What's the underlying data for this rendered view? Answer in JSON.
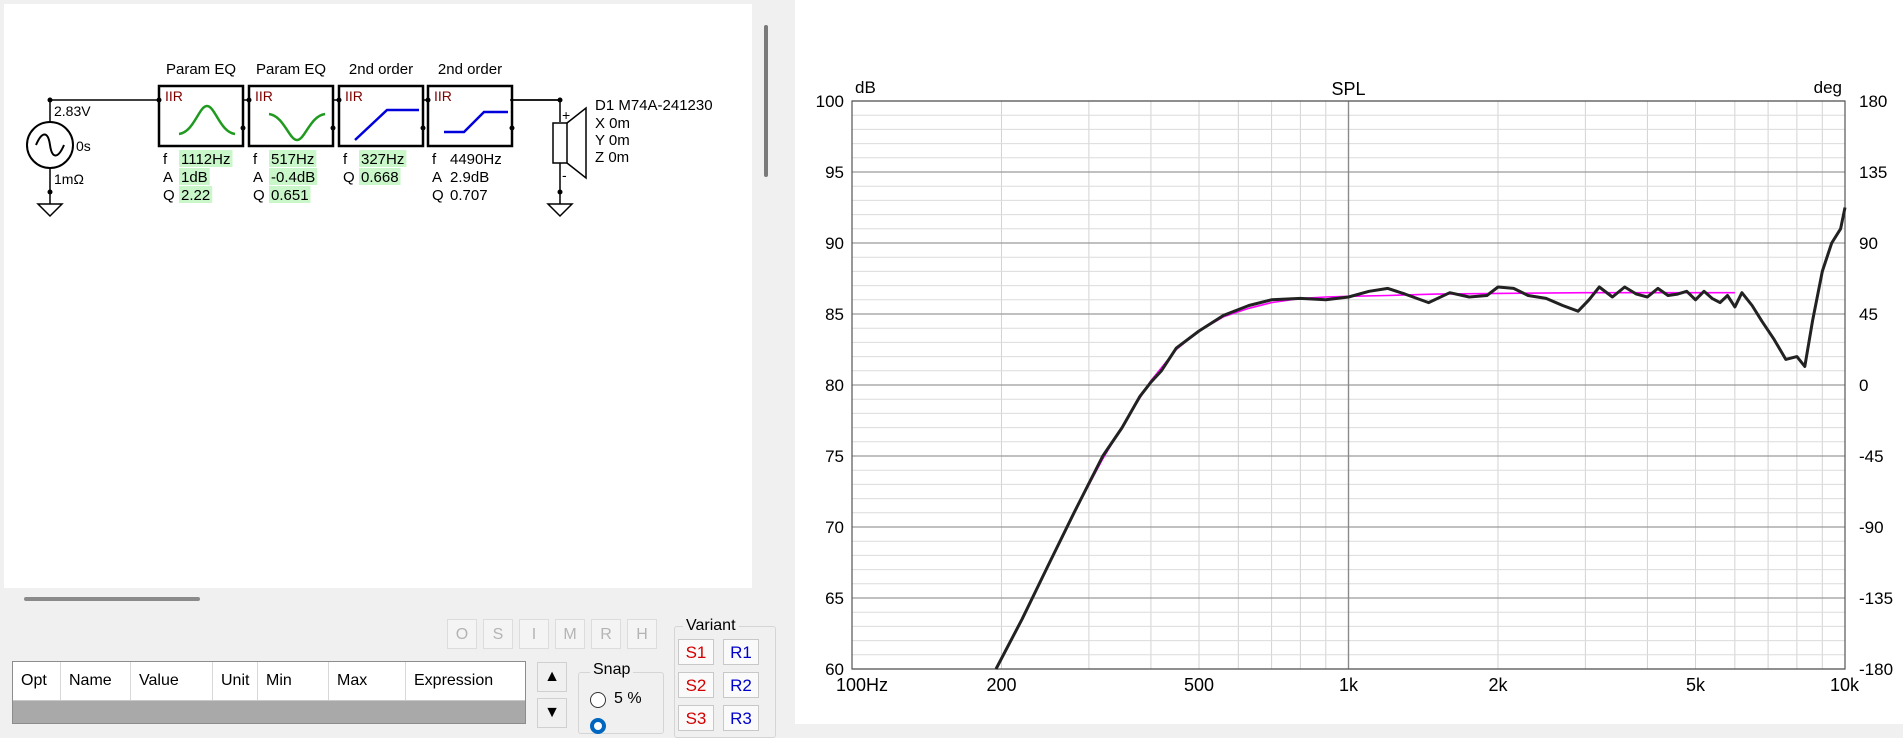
{
  "schematic": {
    "source": {
      "voltage": "2.83V",
      "delay": "0s",
      "impedance": "1mΩ"
    },
    "blocks": [
      {
        "title": "Param EQ",
        "tag": "IIR",
        "shape": "peak",
        "params": [
          {
            "key": "f",
            "val": "1112Hz",
            "hl": true
          },
          {
            "key": "A",
            "val": "1dB",
            "hl": true
          },
          {
            "key": "Q",
            "val": "2.22",
            "hl": true
          }
        ]
      },
      {
        "title": "Param EQ",
        "tag": "IIR",
        "shape": "dip",
        "params": [
          {
            "key": "f",
            "val": "517Hz",
            "hl": true
          },
          {
            "key": "A",
            "val": "-0.4dB",
            "hl": true
          },
          {
            "key": "Q",
            "val": "0.651",
            "hl": true
          }
        ]
      },
      {
        "title": "2nd order",
        "tag": "IIR",
        "shape": "highpass",
        "params": [
          {
            "key": "f",
            "val": "327Hz",
            "hl": true
          },
          {
            "key": "Q",
            "val": "0.668",
            "hl": true
          }
        ]
      },
      {
        "title": "2nd order",
        "tag": "IIR",
        "shape": "shelf",
        "params": [
          {
            "key": "f",
            "val": "4490Hz",
            "hl": false
          },
          {
            "key": "A",
            "val": "2.9dB",
            "hl": false
          },
          {
            "key": "Q",
            "val": "0.707",
            "hl": false
          }
        ]
      }
    ],
    "driver": {
      "name": "D1 M74A-241230",
      "x": "X 0m",
      "y": "Y 0m",
      "z": "Z 0m",
      "plus": "+",
      "minus": "-"
    }
  },
  "toolbar": {
    "buttons": [
      "O",
      "S",
      "I",
      "M",
      "R",
      "H"
    ]
  },
  "table": {
    "headers": [
      "Opt",
      "Name",
      "Value",
      "Unit",
      "Min",
      "Max",
      "Expression"
    ]
  },
  "snap": {
    "label": "Snap",
    "option": "5 %"
  },
  "variant": {
    "label": "Variant",
    "s_buttons": [
      "S1",
      "S2",
      "S3"
    ],
    "r_buttons": [
      "R1",
      "R2",
      "R3"
    ]
  },
  "colors": {
    "response": "#222222",
    "target": "#ff00ff",
    "param_highlight": "#c9f7c9",
    "filter_green": "#1f9a1f",
    "filter_blue": "#0000dd"
  },
  "chart_data": {
    "type": "line",
    "title": "SPL",
    "ylabel": "dB",
    "y2label": "deg",
    "xscale": "log",
    "xlim": [
      100,
      10000
    ],
    "ylim": [
      60,
      100
    ],
    "y2lim": [
      -180,
      180
    ],
    "x_ticks": [
      {
        "v": 100,
        "label": "100Hz"
      },
      {
        "v": 200,
        "label": "200"
      },
      {
        "v": 500,
        "label": "500"
      },
      {
        "v": 1000,
        "label": "1k"
      },
      {
        "v": 2000,
        "label": "2k"
      },
      {
        "v": 5000,
        "label": "5k"
      },
      {
        "v": 10000,
        "label": "10k"
      }
    ],
    "y_ticks": [
      100,
      95,
      90,
      85,
      80,
      75,
      70,
      65,
      60
    ],
    "y2_ticks": [
      180,
      135,
      90,
      45,
      0,
      -45,
      -90,
      -135,
      -180
    ],
    "grid": true,
    "series": [
      {
        "role": "target",
        "x": [
          195,
          220,
          250,
          280,
          320,
          360,
          400,
          450,
          500,
          560,
          630,
          700,
          800,
          900,
          1000,
          1200,
          1500,
          2000,
          3000,
          4000,
          5000,
          6000
        ],
        "y": [
          60,
          63.5,
          67.5,
          71,
          74.8,
          77.8,
          80.3,
          82.5,
          83.8,
          84.8,
          85.4,
          85.8,
          86.1,
          86.2,
          86.25,
          86.3,
          86.4,
          86.45,
          86.5,
          86.5,
          86.5,
          86.5
        ]
      },
      {
        "role": "response",
        "x": [
          195,
          220,
          250,
          280,
          320,
          350,
          380,
          400,
          420,
          450,
          500,
          560,
          630,
          700,
          800,
          900,
          1000,
          1100,
          1200,
          1300,
          1450,
          1600,
          1750,
          1900,
          2000,
          2150,
          2300,
          2500,
          2700,
          2900,
          3050,
          3200,
          3400,
          3600,
          3800,
          4000,
          4200,
          4400,
          4600,
          4800,
          5000,
          5200,
          5400,
          5600,
          5800,
          6000,
          6200,
          6500,
          6800,
          7200,
          7600,
          8000,
          8300,
          8600,
          9000,
          9400,
          9800,
          10000
        ],
        "y": [
          60,
          63.5,
          67.5,
          71,
          75,
          77,
          79.2,
          80.2,
          81,
          82.6,
          83.8,
          84.9,
          85.6,
          86,
          86.1,
          86,
          86.2,
          86.6,
          86.8,
          86.4,
          85.8,
          86.5,
          86.2,
          86.3,
          86.9,
          86.8,
          86.3,
          86.1,
          85.6,
          85.2,
          86,
          86.9,
          86.2,
          86.9,
          86.4,
          86.2,
          86.8,
          86.3,
          86.4,
          86.6,
          86,
          86.6,
          86.1,
          85.8,
          86.3,
          85.5,
          86.5,
          85.6,
          84.5,
          83.2,
          81.8,
          82,
          81.3,
          84.5,
          88,
          90,
          91,
          92.5
        ]
      }
    ]
  }
}
